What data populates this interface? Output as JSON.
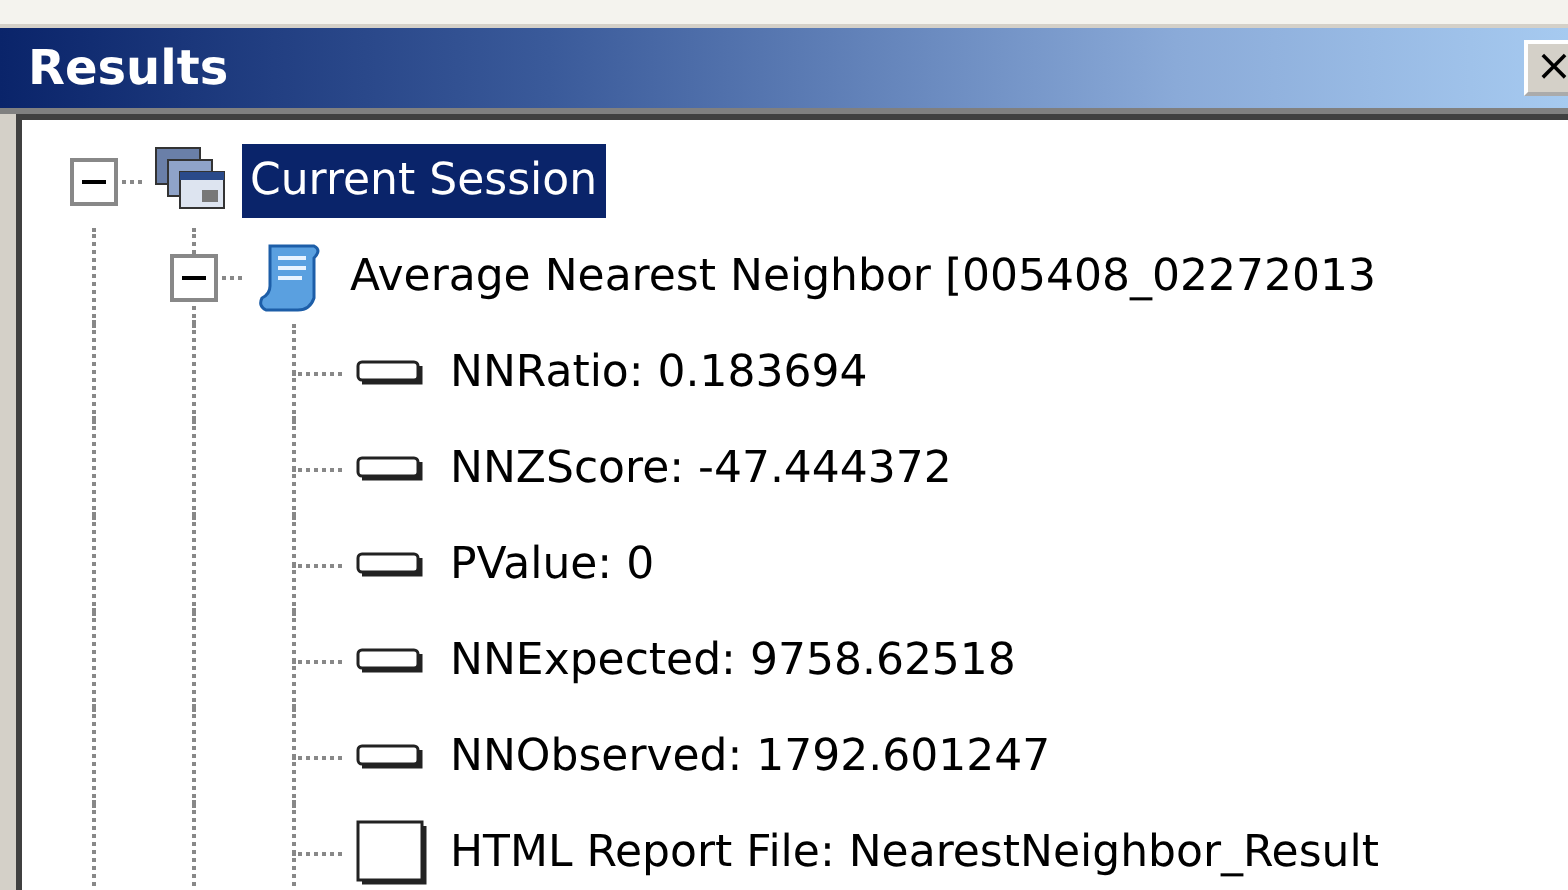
{
  "window": {
    "title": "Results",
    "close_label": "×"
  },
  "tree": [
    {
      "kind": "session",
      "label": "Current Session",
      "selected": true,
      "expanded": true,
      "children": [
        {
          "kind": "tool",
          "label": "Average Nearest Neighbor [005408_02272013",
          "selected": false,
          "expanded": true,
          "children": [
            {
              "kind": "value",
              "label": "NNRatio: 0.183694",
              "selected": false
            },
            {
              "kind": "value",
              "label": "NNZScore: -47.444372",
              "selected": false
            },
            {
              "kind": "value",
              "label": "PValue: 0",
              "selected": false
            },
            {
              "kind": "value",
              "label": "NNExpected: 9758.62518",
              "selected": false
            },
            {
              "kind": "value",
              "label": "NNObserved: 1792.601247",
              "selected": false
            },
            {
              "kind": "report",
              "label": "HTML Report File: NearestNeighbor_Result",
              "selected": false
            }
          ]
        }
      ]
    }
  ]
}
